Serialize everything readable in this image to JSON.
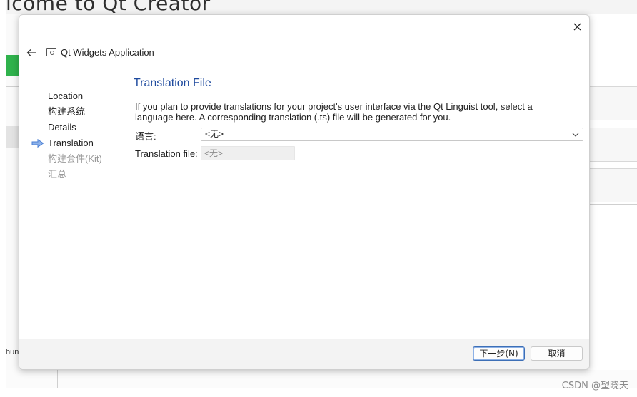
{
  "background": {
    "title": "lcome to Qt Creator",
    "bottom_text": "hun"
  },
  "dialog": {
    "header": {
      "app_title": "Qt Widgets Application"
    },
    "steps": [
      {
        "label": "Location",
        "state": "done"
      },
      {
        "label": "构建系统",
        "state": "done"
      },
      {
        "label": "Details",
        "state": "done"
      },
      {
        "label": "Translation",
        "state": "current"
      },
      {
        "label": "构建套件(Kit)",
        "state": "pending"
      },
      {
        "label": "汇总",
        "state": "pending"
      }
    ],
    "page_title": "Translation File",
    "description": "If you plan to provide translations for your project's user interface via the Qt Linguist tool, select a language here. A corresponding translation (.ts) file will be generated for you.",
    "language_label": "语言:",
    "language_value": "<无>",
    "ts_file_label": "Translation file:",
    "ts_file_value": "<无>",
    "buttons": {
      "next": "下一步(N)",
      "cancel": "取消"
    }
  },
  "watermark": "CSDN @望晓天",
  "colors": {
    "accent_title": "#1e4a9e",
    "arrow": "#4a7fd4",
    "disabled_text": "#9a9a9a",
    "green": "#2fb24c"
  }
}
